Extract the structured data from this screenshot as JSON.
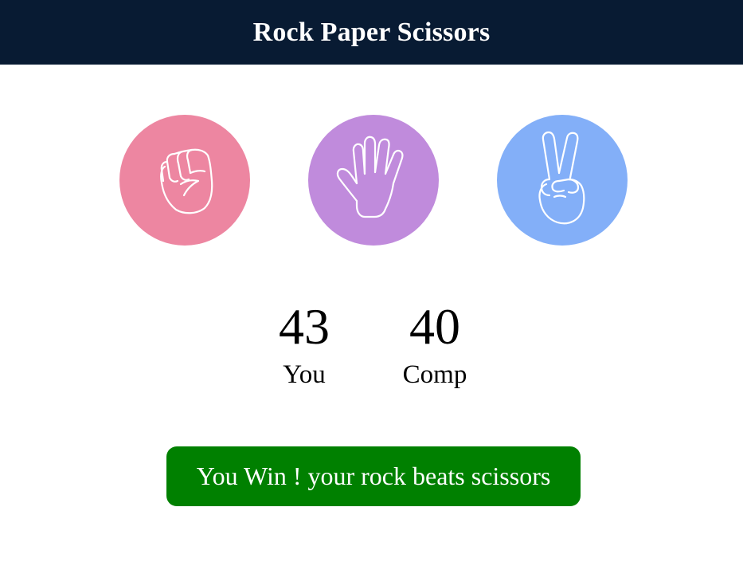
{
  "header": {
    "title": "Rock Paper Scissors"
  },
  "choices": [
    {
      "id": "rock",
      "icon": "fist-icon",
      "color": "#ed86a1"
    },
    {
      "id": "paper",
      "icon": "open-hand-icon",
      "color": "#c08bdc"
    },
    {
      "id": "scissors",
      "icon": "peace-hand-icon",
      "color": "#83aff8"
    }
  ],
  "scoreboard": {
    "user": {
      "score": "43",
      "label": "You"
    },
    "comp": {
      "score": "40",
      "label": "Comp"
    }
  },
  "message": {
    "text": "You Win ! your rock beats scissors",
    "color": "#008000"
  }
}
